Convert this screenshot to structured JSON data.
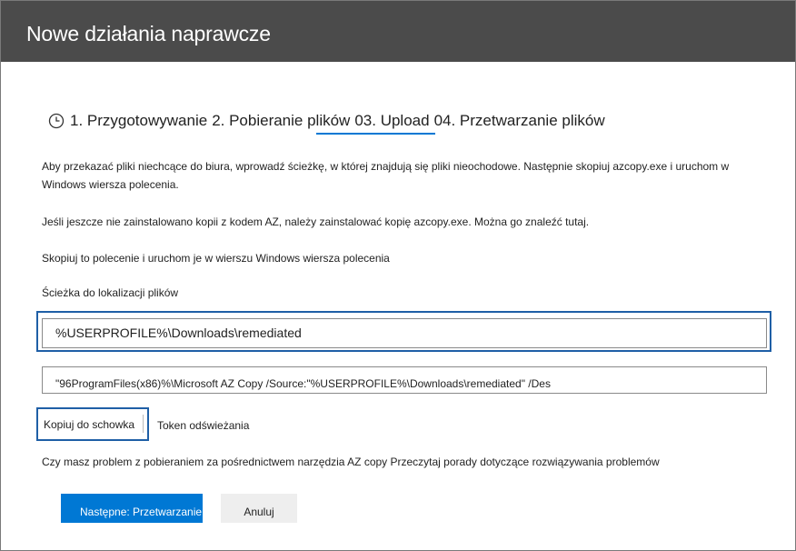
{
  "dialog": {
    "title": "Nowe działania naprawcze"
  },
  "steps": [
    {
      "label": "1. Przygotowywanie"
    },
    {
      "label": "2. Pobieranie plików"
    },
    {
      "label": "03. Upload"
    },
    {
      "label": "04. Przetwarzanie plików"
    }
  ],
  "content": {
    "intro_line1": "Aby przekazać pliki niechcące do biura, wprowadź ścieżkę, w której znajdują się pliki nieochodowe. Następnie skopiuj azcopy.exe i uruchom w",
    "intro_line2": "Windows wiersza polecenia.",
    "azcopy_note": "Jeśli jeszcze nie zainstalowano kopii z kodem AZ, należy zainstalować kopię azcopy.exe. Można go znaleźć tutaj.",
    "copy_instruction": "Skopiuj to polecenie i uruchom je w wierszu Windows wiersza polecenia",
    "path_label": "Ścieżka do lokalizacji plików",
    "path_value": "%USERPROFILE%\\Downloads\\remediated",
    "command_value": "\"96ProgramFiles(x86)%\\Microsoft AZ Copy /Source:\"%USERPROFILE%\\Downloads\\remediated\" /Des",
    "copy_button": "Kopiuj do schowka",
    "refresh_token": "Token odświeżania",
    "help_text": "Czy masz problem z pobieraniem za pośrednictwem narzędzia AZ copy Przeczytaj porady dotyczące rozwiązywania problemów"
  },
  "footer": {
    "next_button": "Następne: Przetwarzanie plików",
    "cancel_button": "Anuluj"
  },
  "colors": {
    "header_bg": "#4b4b4b",
    "accent": "#0078d4",
    "focus_border": "#1f5fa6"
  },
  "icons": {
    "steps_icon": "clock-icon"
  }
}
